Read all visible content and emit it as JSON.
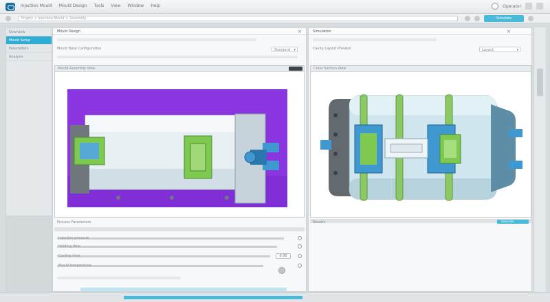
{
  "titlebar": {
    "menu": [
      "Injection Mould",
      "Mould Design",
      "Tools",
      "View",
      "Window",
      "Help"
    ],
    "user_label": "Operator"
  },
  "toolbar": {
    "address": "Project > Injection Mould > Assembly",
    "accent_label": "Simulate"
  },
  "sidebar": {
    "items": [
      "Overview",
      "Mould Setup",
      "Parameters",
      "Analysis"
    ],
    "active_index": 1
  },
  "left_panel": {
    "header": "Mould Design",
    "sub_label": "Mould Base Configuration",
    "dropdown_label": "Standard",
    "section_label": "Mould Assembly View",
    "footer_label": "Process Parameters",
    "rows": [
      "Injection pressure",
      "Holding time",
      "Cooling time",
      "Mould temperature"
    ],
    "stepper_value": "0.00"
  },
  "right_panel": {
    "header": "Simulation",
    "sub_label": "Cavity Layout Preview",
    "dropdown_label": "Layout",
    "section_label": "Cross Section View",
    "footer_label": "Results",
    "accent_tag": "Generate"
  },
  "colors": {
    "accent": "#2eaed4",
    "purple_bg": "#8a35e0",
    "mould_green": "#7ec94f",
    "mould_blue": "#3f98d0",
    "body_light": "#e9f1f5"
  },
  "icons": [
    "logo-icon",
    "close-icon",
    "chevron-down-icon",
    "search-icon",
    "gear-icon"
  ]
}
